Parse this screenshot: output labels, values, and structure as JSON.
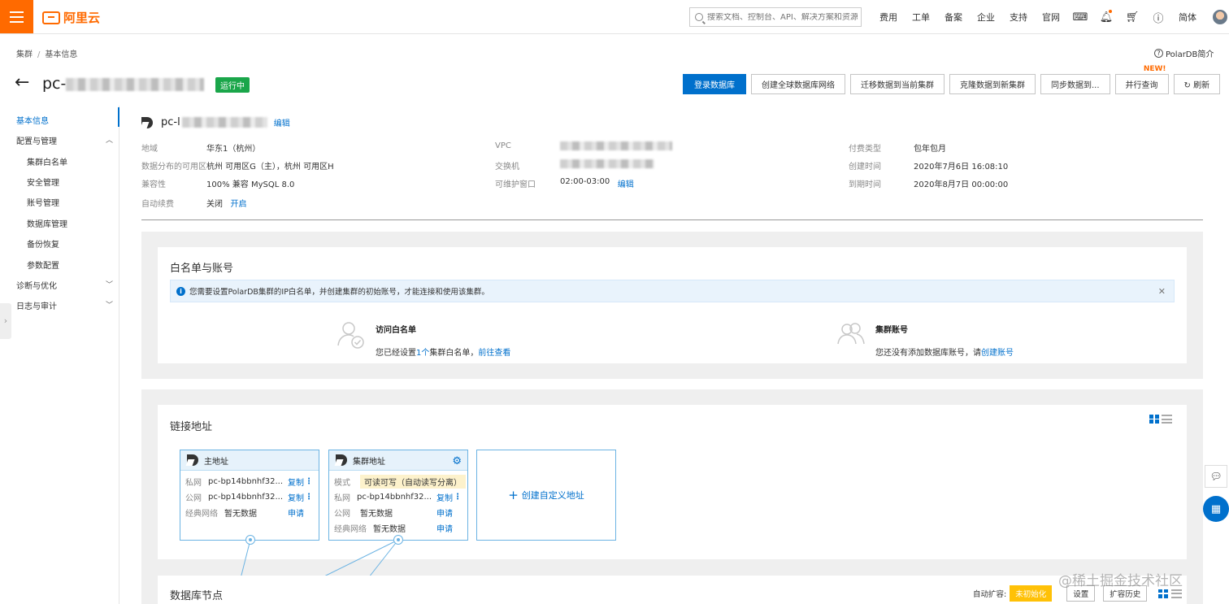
{
  "topbar": {
    "brand": "阿里云",
    "search_placeholder": "搜索文档、控制台、API、解决方案和资源",
    "nav": [
      "费用",
      "工单",
      "备案",
      "企业",
      "支持",
      "官网"
    ],
    "lang": "简体"
  },
  "breadcrumb": [
    "集群",
    "基本信息"
  ],
  "polardb_intro": "PolarDB简介",
  "header": {
    "title_prefix": "pc-",
    "status": "运行中",
    "actions": [
      "登录数据库",
      "创建全球数据库网络",
      "迁移数据到当前集群",
      "克隆数据到新集群",
      "同步数据到...",
      "并行查询",
      "刷新"
    ],
    "new_badge": "NEW!"
  },
  "sidebar": {
    "items": [
      {
        "label": "基本信息"
      },
      {
        "label": "配置与管理"
      },
      {
        "label": "集群白名单"
      },
      {
        "label": "安全管理"
      },
      {
        "label": "账号管理"
      },
      {
        "label": "数据库管理"
      },
      {
        "label": "备份恢复"
      },
      {
        "label": "参数配置"
      },
      {
        "label": "诊断与优化"
      },
      {
        "label": "日志与审计"
      }
    ]
  },
  "cluster_info": {
    "name_prefix": "pc-l",
    "edit": "编辑",
    "region_label": "地域",
    "region": "华东1（杭州）",
    "zones_label": "数据分布的可用区",
    "zones": "杭州 可用区G（主），杭州 可用区H",
    "compat_label": "兼容性",
    "compat": "100% 兼容 MySQL 8.0",
    "renew_label": "自动续费",
    "renew": "关闭",
    "renew_action": "开启",
    "vpc_label": "VPC",
    "vswitch_label": "交换机",
    "maint_label": "可维护窗口",
    "maint": "02:00-03:00",
    "maint_edit": "编辑",
    "pay_label": "付费类型",
    "pay": "包年包月",
    "created_label": "创建时间",
    "created": "2020年7月6日 16:08:10",
    "expire_label": "到期时间",
    "expire": "2020年8月7日 00:00:00"
  },
  "whitelist": {
    "title": "白名单与账号",
    "notice": "您需要设置PolarDB集群的IP白名单，并创建集群的初始账号，才能连接和使用该集群。",
    "access_title": "访问白名单",
    "access_text_a": "您已经设置",
    "access_count": "1个",
    "access_text_b": "集群白名单，",
    "access_link": "前往查看",
    "account_title": "集群账号",
    "account_text": "您还没有添加数据库账号，请",
    "account_link": "创建账号"
  },
  "endpoints": {
    "title": "链接地址",
    "primary": {
      "title": "主地址",
      "private_label": "私网",
      "private": "pc-bp14bbnhf32...",
      "private_op": "复制",
      "public_label": "公网",
      "public": "pc-bp14bbnhf32...",
      "public_op": "复制",
      "classic_label": "经典网络",
      "classic": "暂无数据",
      "classic_op": "申请"
    },
    "cluster": {
      "title": "集群地址",
      "mode_label": "模式",
      "mode": "可读可写（自动读写分离）",
      "private_label": "私网",
      "private": "pc-bp14bbnhf32...",
      "private_op": "复制",
      "public_label": "公网",
      "public": "暂无数据",
      "public_op": "申请",
      "classic_label": "经典网络",
      "classic": "暂无数据",
      "classic_op": "申请"
    },
    "create": "创建自定义地址"
  },
  "nodes": {
    "title": "数据库节点",
    "auto_scale_label": "自动扩容:",
    "auto_scale_value": "未初始化",
    "settings": "设置",
    "history": "扩容历史"
  },
  "watermark": "@稀土掘金技术社区",
  "colors": {
    "brand": "#ff6a00",
    "primary": "#0070cc",
    "running": "#1aa64a",
    "warning": "#ffc107"
  }
}
